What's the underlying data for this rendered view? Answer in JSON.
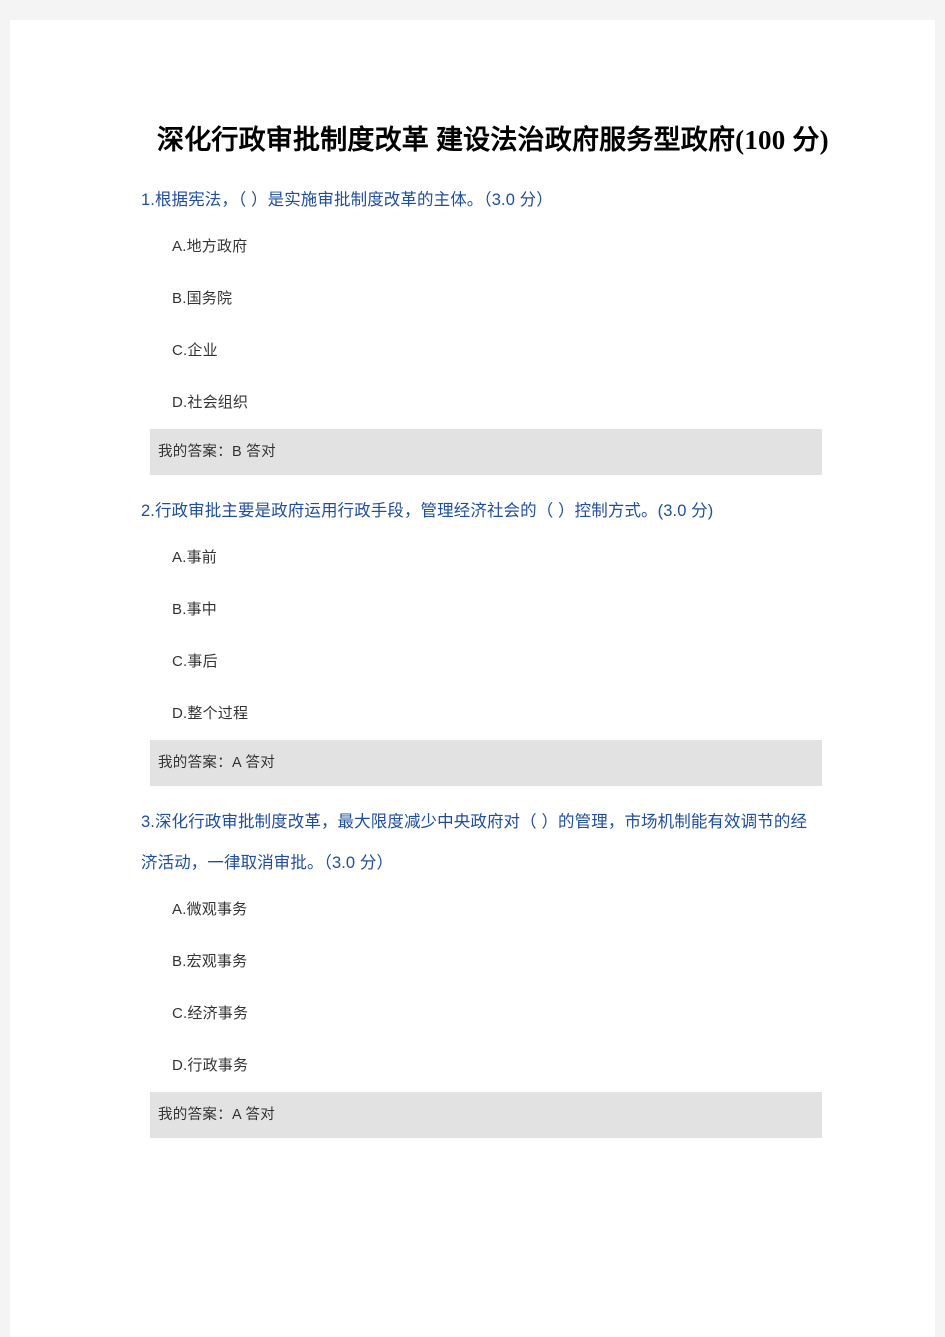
{
  "document": {
    "title": "深化行政审批制度改革 建设法治政府服务型政府(100 分)",
    "background_color": "#f4f4f4",
    "sheet_color": "#ffffff",
    "question_color": "#1f4e9c",
    "option_color": "#333333",
    "answer_bar_color": "#e2e2e2"
  },
  "questions": [
    {
      "text": "1.根据宪法，（ ）是实施审批制度改革的主体。（3.0 分）",
      "options": [
        "A.地方政府",
        "B.国务院",
        "C.企业",
        "D.社会组织"
      ],
      "answer": "我的答案：B 答对"
    },
    {
      "text": "2.行政审批主要是政府运用行政手段，管理经济社会的（ ）控制方式。(3.0 分)",
      "options": [
        "A.事前",
        "B.事中",
        "C.事后",
        "D.整个过程"
      ],
      "answer": "我的答案：A 答对"
    },
    {
      "text": "3.深化行政审批制度改革，最大限度减少中央政府对（ ）的管理，市场机制能有效调节的经济活动，一律取消审批。（3.0 分）",
      "options": [
        "A.微观事务",
        "B.宏观事务",
        "C.经济事务",
        "D.行政事务"
      ],
      "answer": "我的答案：A 答对"
    }
  ]
}
